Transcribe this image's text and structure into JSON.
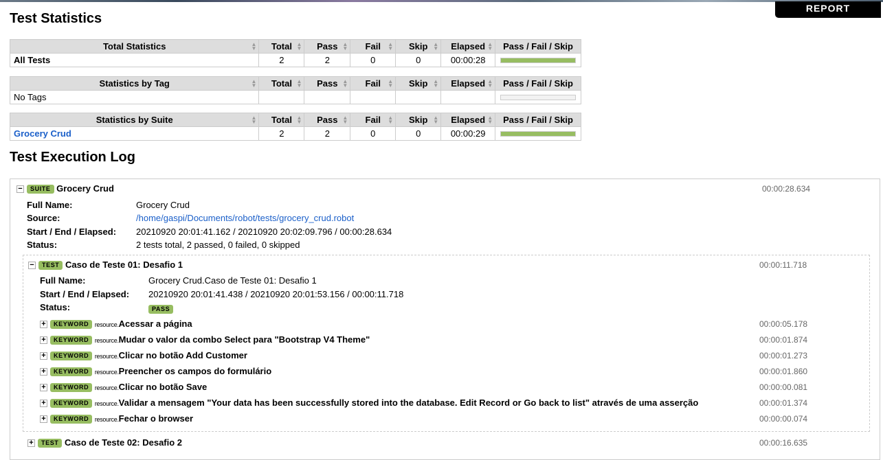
{
  "report_button": "REPORT",
  "stats_heading": "Test Statistics",
  "columns": [
    "Total",
    "Pass",
    "Fail",
    "Skip",
    "Elapsed",
    "Pass / Fail / Skip"
  ],
  "total_stats": {
    "header": "Total Statistics",
    "rows": [
      {
        "name": "All Tests",
        "total": "2",
        "pass": "2",
        "fail": "0",
        "skip": "0",
        "elapsed": "00:00:28",
        "pass_fraction": 1
      }
    ]
  },
  "tag_stats": {
    "header": "Statistics by Tag",
    "rows": [
      {
        "name": "No Tags",
        "total": "",
        "pass": "",
        "fail": "",
        "skip": "",
        "elapsed": "",
        "pass_fraction": 0
      }
    ]
  },
  "suite_stats": {
    "header": "Statistics by Suite",
    "rows": [
      {
        "name": "Grocery Crud",
        "total": "2",
        "pass": "2",
        "fail": "0",
        "skip": "0",
        "elapsed": "00:00:29",
        "pass_fraction": 1
      }
    ]
  },
  "colors": {
    "pass": "#97bd61",
    "link": "#1a5fc9"
  },
  "log_heading": "Test Execution Log",
  "suite": {
    "badge": "SUITE",
    "name": "Grocery Crud",
    "elapsed": "00:00:28.634",
    "labels": {
      "full_name": "Full Name:",
      "source": "Source:",
      "times": "Start / End / Elapsed:",
      "status": "Status:"
    },
    "full_name": "Grocery Crud",
    "source": "/home/gaspi/Documents/robot/tests/grocery_crud.robot",
    "times": "20210920 20:01:41.162 / 20210920 20:02:09.796 / 00:00:28.634",
    "status": "2 tests total, 2 passed, 0 failed, 0 skipped"
  },
  "test1": {
    "badge": "TEST",
    "name": "Caso de Teste 01: Desafio 1",
    "elapsed": "00:00:11.718",
    "full_name": "Grocery Crud.Caso de Teste 01: Desafio 1",
    "times": "20210920 20:01:41.438 / 20210920 20:01:53.156 / 00:00:11.718",
    "status": "PASS",
    "keywords": [
      {
        "badge": "KEYWORD",
        "prefix": "resource.",
        "name": "Acessar a página",
        "elapsed": "00:00:05.178"
      },
      {
        "badge": "KEYWORD",
        "prefix": "resource.",
        "name": "Mudar o valor da combo Select para \"Bootstrap V4 Theme\"",
        "elapsed": "00:00:01.874"
      },
      {
        "badge": "KEYWORD",
        "prefix": "resource.",
        "name": "Clicar no botão Add Customer",
        "elapsed": "00:00:01.273"
      },
      {
        "badge": "KEYWORD",
        "prefix": "resource.",
        "name": "Preencher os campos do formulário",
        "elapsed": "00:00:01.860"
      },
      {
        "badge": "KEYWORD",
        "prefix": "resource.",
        "name": "Clicar no botão Save",
        "elapsed": "00:00:00.081"
      },
      {
        "badge": "KEYWORD",
        "prefix": "resource.",
        "name": "Validar a mensagem \"Your data has been successfully stored into the database. Edit Record or Go back to list\" através de uma asserção",
        "elapsed": "00:00:01.374"
      },
      {
        "badge": "KEYWORD",
        "prefix": "resource.",
        "name": "Fechar o browser",
        "elapsed": "00:00:00.074"
      }
    ]
  },
  "test2": {
    "badge": "TEST",
    "name": "Caso de Teste 02: Desafio 2",
    "elapsed": "00:00:16.635"
  }
}
